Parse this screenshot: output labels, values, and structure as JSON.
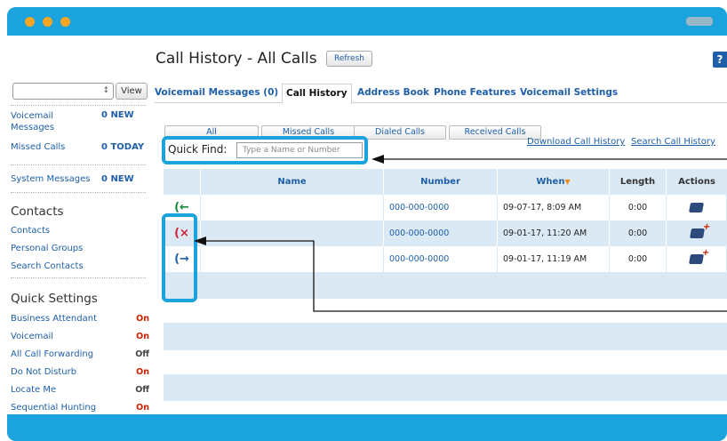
{
  "app": {
    "page_title": "Call History - All Calls",
    "refresh_label": "Refresh",
    "help_label": "?"
  },
  "sidebar": {
    "view_label": "View",
    "select_value": "↕",
    "voicemail_label": "Voicemail Messages",
    "voicemail_value": "0 NEW",
    "missed_label": "Missed Calls",
    "missed_value": "0 TODAY",
    "system_label": "System Messages",
    "system_value": "0 NEW",
    "contacts_heading": "Contacts",
    "contacts_links": [
      "Contacts",
      "Personal Groups",
      "Search Contacts"
    ],
    "quick_settings_heading": "Quick Settings",
    "quick_settings": [
      {
        "label": "Business Attendant",
        "value": "On"
      },
      {
        "label": "Voicemail",
        "value": "On"
      },
      {
        "label": "All Call Forwarding",
        "value": "Off"
      },
      {
        "label": "Do Not Disturb",
        "value": "On"
      },
      {
        "label": "Locate Me",
        "value": "Off"
      },
      {
        "label": "Sequential Hunting",
        "value": "On"
      }
    ]
  },
  "tabs": [
    "Voicemail Messages (0)",
    "Call History",
    "Address Book",
    "Phone Features",
    "Voicemail Settings"
  ],
  "filters": [
    "All",
    "Missed Calls",
    "Dialed Calls",
    "Received Calls"
  ],
  "quick_find": {
    "label": "Quick Find:",
    "placeholder": "Type a Name or Number"
  },
  "links": {
    "download": "Download Call History",
    "search": "Search Call History"
  },
  "table": {
    "columns": [
      "Name",
      "Number",
      "When",
      "Length",
      "Actions"
    ],
    "rows": [
      {
        "type": "incoming",
        "icon": "(←",
        "name": "",
        "number": "000-000-0000",
        "when": "09-07-17, 8:09 AM",
        "length": "0:00"
      },
      {
        "type": "missed",
        "icon": "(×",
        "name": "",
        "number": "000-000-0000",
        "when": "09-01-17, 11:20 AM",
        "length": "0:00"
      },
      {
        "type": "outgoing",
        "icon": "(→",
        "name": "",
        "number": "000-000-0000",
        "when": "09-01-17, 11:19 AM",
        "length": "0:00"
      }
    ]
  },
  "colors": {
    "frame": "#1aa3dc",
    "link": "#1e5fa8",
    "accent_orange": "#f6a623",
    "row_alt": "#dbe9f5",
    "status_on": "#cc2200"
  }
}
